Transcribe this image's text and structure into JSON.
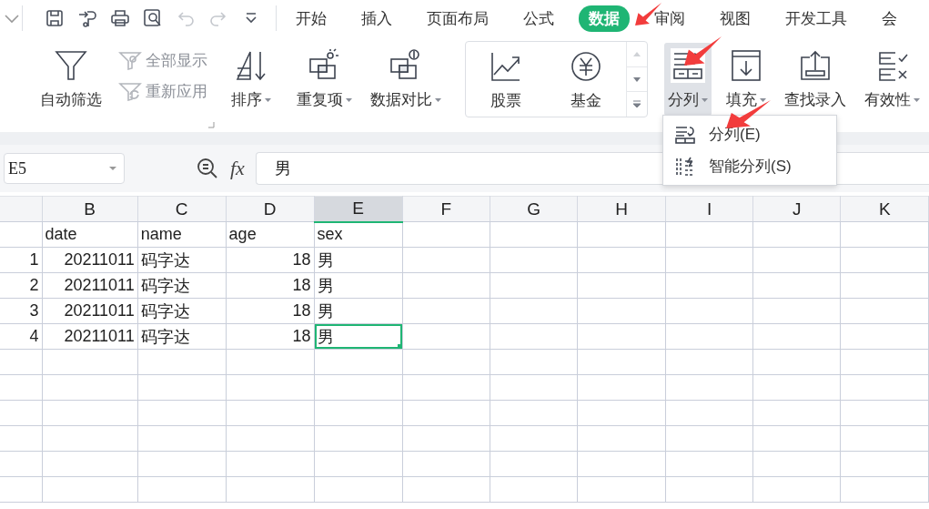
{
  "quick_tools": [
    {
      "kind": "save",
      "disabled": false
    },
    {
      "kind": "format_painter",
      "disabled": false
    },
    {
      "kind": "print",
      "disabled": false
    },
    {
      "kind": "print_preview",
      "disabled": false
    },
    {
      "kind": "undo",
      "disabled": true
    },
    {
      "kind": "redo",
      "disabled": true
    },
    {
      "kind": "more",
      "disabled": false
    }
  ],
  "tabs": [
    {
      "label": "开始",
      "selected": false
    },
    {
      "label": "插入",
      "selected": false
    },
    {
      "label": "页面布局",
      "selected": false
    },
    {
      "label": "公式",
      "selected": false
    },
    {
      "label": "数据",
      "selected": true
    },
    {
      "label": "审阅",
      "selected": false
    },
    {
      "label": "视图",
      "selected": false
    },
    {
      "label": "开发工具",
      "selected": false
    },
    {
      "label": "会",
      "selected": false
    }
  ],
  "ribbon": {
    "sections": [
      {
        "kind": "filter",
        "items": [
          {
            "kind": "filter",
            "label": "自动筛选",
            "disabled": false
          },
          {
            "kind": "show_all",
            "label": "全部显示",
            "disabled": true
          },
          {
            "kind": "reapply",
            "label": "重新应用",
            "disabled": true
          }
        ]
      },
      {
        "kind": "tools",
        "items": [
          {
            "kind": "sort",
            "label": "排序",
            "dropdown": true,
            "selected": false
          }
        ]
      },
      {
        "kind": "tools",
        "items": [
          {
            "kind": "duplicates",
            "label": "重复项",
            "dropdown": true,
            "selected": false
          },
          {
            "kind": "compare",
            "label": "数据对比",
            "dropdown": true,
            "selected": false
          }
        ]
      },
      {
        "kind": "gallery",
        "items": [
          {
            "kind": "stock",
            "label": "股票"
          },
          {
            "kind": "fund",
            "label": "基金"
          }
        ]
      },
      {
        "kind": "tools",
        "items": [
          {
            "kind": "split",
            "label": "分列",
            "dropdown": true,
            "selected": true
          },
          {
            "kind": "fill",
            "label": "填充",
            "dropdown": true,
            "selected": false
          },
          {
            "kind": "lookup",
            "label": "查找录入",
            "dropdown": false,
            "selected": false
          },
          {
            "kind": "validity",
            "label": "有效性",
            "dropdown": true,
            "selected": false
          }
        ]
      }
    ]
  },
  "formula_bar": {
    "cell_ref": "E5",
    "fx_label": "fx",
    "formula": "男"
  },
  "menu": {
    "items": [
      {
        "kind": "split",
        "label": "分列(E)"
      },
      {
        "kind": "smart_split",
        "label": "智能分列(S)"
      }
    ]
  },
  "sheet": {
    "columns": [
      {
        "label": "B",
        "selected": false
      },
      {
        "label": "C",
        "selected": false
      },
      {
        "label": "D",
        "selected": false
      },
      {
        "label": "E",
        "selected": true
      },
      {
        "label": "F",
        "selected": false
      },
      {
        "label": "G",
        "selected": false
      },
      {
        "label": "H",
        "selected": false
      },
      {
        "label": "I",
        "selected": false
      },
      {
        "label": "J",
        "selected": false
      },
      {
        "label": "K",
        "selected": false
      }
    ],
    "rows": [
      {
        "cells": [
          {
            "text": "date",
            "kind": "text",
            "selected": false
          },
          {
            "text": "name",
            "kind": "text",
            "selected": false
          },
          {
            "text": "age",
            "kind": "text",
            "selected": false
          },
          {
            "text": "sex",
            "kind": "text",
            "selected": false
          }
        ]
      },
      {
        "number": "1",
        "cells": [
          {
            "text": "20211011",
            "kind": "number",
            "selected": false
          },
          {
            "text": "码字达",
            "kind": "text",
            "selected": false
          },
          {
            "text": "18",
            "kind": "number",
            "selected": false
          },
          {
            "text": "男",
            "kind": "text",
            "selected": false
          }
        ]
      },
      {
        "number": "2",
        "cells": [
          {
            "text": "20211011",
            "kind": "number",
            "selected": false
          },
          {
            "text": "码字达",
            "kind": "text",
            "selected": false
          },
          {
            "text": "18",
            "kind": "number",
            "selected": false
          },
          {
            "text": "男",
            "kind": "text",
            "selected": false
          }
        ]
      },
      {
        "number": "3",
        "cells": [
          {
            "text": "20211011",
            "kind": "number",
            "selected": false
          },
          {
            "text": "码字达",
            "kind": "text",
            "selected": false
          },
          {
            "text": "18",
            "kind": "number",
            "selected": false
          },
          {
            "text": "男",
            "kind": "text",
            "selected": false
          }
        ]
      },
      {
        "number": "4",
        "cells": [
          {
            "text": "20211011",
            "kind": "number",
            "selected": false
          },
          {
            "text": "码字达",
            "kind": "text",
            "selected": false
          },
          {
            "text": "18",
            "kind": "number",
            "selected": false
          },
          {
            "text": "男",
            "kind": "text",
            "selected": true
          }
        ]
      }
    ]
  }
}
